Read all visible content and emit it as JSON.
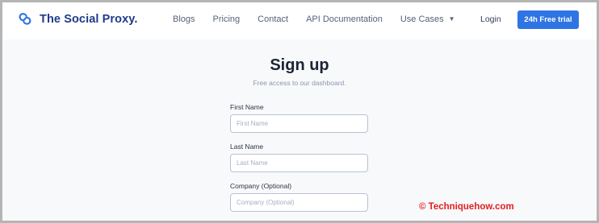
{
  "brand": {
    "name": "The Social Proxy."
  },
  "nav": {
    "links": [
      "Blogs",
      "Pricing",
      "Contact",
      "API Documentation",
      "Use Cases"
    ],
    "login": "Login",
    "cta": "24h Free trial"
  },
  "form": {
    "title": "Sign up",
    "subtitle": "Free access to our dashboard.",
    "fields": [
      {
        "label": "First Name",
        "placeholder": "First Name"
      },
      {
        "label": "Last Name",
        "placeholder": "Last Name"
      },
      {
        "label": "Company (Optional)",
        "placeholder": "Company (Optional)"
      }
    ]
  },
  "watermark": "© Techniquehow.com",
  "colors": {
    "accent": "#2f74e4",
    "brand": "#1f3b8c",
    "watermark": "#e02020"
  }
}
